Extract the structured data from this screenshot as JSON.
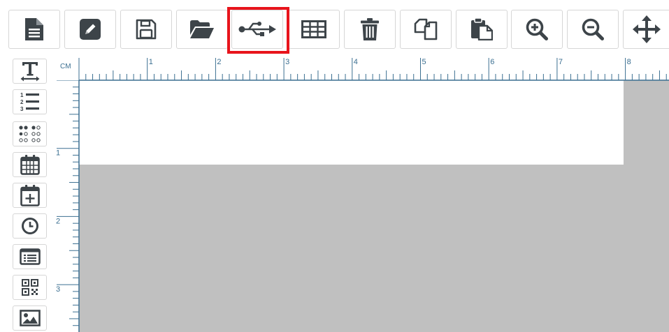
{
  "colors": {
    "icon": "#3d4449",
    "ruler": "#3b6f91",
    "highlight": "#e8141c",
    "canvas_bg": "#c0c0c0",
    "label_bg": "#ffffff"
  },
  "toolbar": {
    "buttons": [
      {
        "name": "new-file-button",
        "icon": "file-icon"
      },
      {
        "name": "edit-button",
        "icon": "pencil-icon"
      },
      {
        "name": "save-button",
        "icon": "floppy-disk-icon"
      },
      {
        "name": "open-button",
        "icon": "folder-open-icon"
      },
      {
        "name": "usb-button",
        "icon": "usb-icon",
        "highlighted": true
      },
      {
        "name": "table-button",
        "icon": "table-icon"
      },
      {
        "name": "delete-button",
        "icon": "trash-icon"
      },
      {
        "name": "copy-button",
        "icon": "copy-icon"
      },
      {
        "name": "paste-button",
        "icon": "paste-icon"
      },
      {
        "name": "zoom-in-button",
        "icon": "zoom-in-icon"
      },
      {
        "name": "zoom-out-button",
        "icon": "zoom-out-icon"
      },
      {
        "name": "move-button",
        "icon": "move-arrows-icon"
      }
    ]
  },
  "sidebar": {
    "tools": [
      {
        "name": "text-tool-button",
        "icon": "text-icon"
      },
      {
        "name": "serial-number-tool-button",
        "icon": "numbered-list-icon"
      },
      {
        "name": "braille-tool-button",
        "icon": "braille-icon"
      },
      {
        "name": "date-tool-button",
        "icon": "calendar-icon"
      },
      {
        "name": "date-offset-tool-button",
        "icon": "calendar-plus-icon"
      },
      {
        "name": "time-tool-button",
        "icon": "clock-icon"
      },
      {
        "name": "database-field-tool-button",
        "icon": "list-box-icon"
      },
      {
        "name": "qr-code-tool-button",
        "icon": "qr-code-icon"
      },
      {
        "name": "image-tool-button",
        "icon": "image-icon"
      }
    ]
  },
  "ruler": {
    "unit": "CM",
    "top_labels": [
      "1",
      "2",
      "3",
      "4",
      "5",
      "6",
      "7",
      "8"
    ],
    "left_labels": [
      "1",
      "2",
      "3"
    ]
  }
}
